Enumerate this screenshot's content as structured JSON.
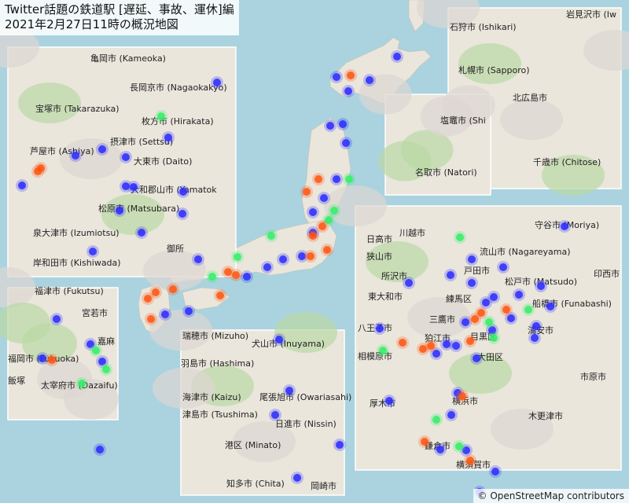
{
  "title": {
    "line1": "Twitter話題の鉄道駅 [遅延、事故、運休]編",
    "line2": "2021年2月27日11時の概況地図"
  },
  "attribution": "© OpenStreetMap contributors",
  "colors": {
    "sea": "#aad3df",
    "land": "#eae6dc",
    "forest": "#b9d8a4",
    "urban": "#ddd6d2",
    "marker_blue": "#2a2aff",
    "marker_green": "#33ee66",
    "marker_orange": "#ff5511"
  },
  "insets": [
    {
      "id": "kansai",
      "labels": [
        "亀岡市 (Kameoka)",
        "長岡京市 (Nagaokakyo)",
        "宝塚市 (Takarazuka)",
        "枚方市 (Hirakata)",
        "摂津市 (Settsu)",
        "芦屋市 (Ashiya)",
        "大東市 (Daito)",
        "大和郡山市 (Yamatok",
        "松原市 (Matsubara)",
        "泉大津市 (Izumiotsu)",
        "岸和田市 (Kishiwada)",
        "御所"
      ]
    },
    {
      "id": "sapporo",
      "labels": [
        "石狩市 (Ishikari)",
        "岩見沢市 (Iw",
        "札幌市 (Sapporo)",
        "北広島市",
        "千歳市 (Chitose)"
      ]
    },
    {
      "id": "sendai",
      "labels": [
        "塩竈市 (Shi",
        "名取市 (Natori)"
      ]
    },
    {
      "id": "tokyo",
      "labels": [
        "川越市",
        "守谷市 (Moriya)",
        "日高市",
        "狭山市",
        "所沢市",
        "戸田市",
        "流山市 (Nagareyama)",
        "印西市",
        "東大和市",
        "練馬区",
        "松戸市 (Matsudo)",
        "船橋市 (Funabashi)",
        "三鷹市",
        "八王子市",
        "狛江市",
        "目黒区",
        "浦安市",
        "相模原市",
        "大田区",
        "厚木市",
        "横浜市",
        "市原市",
        "木更津市",
        "鎌倉市",
        "横須賀市"
      ]
    },
    {
      "id": "fukuoka",
      "labels": [
        "福津市 (Fukutsu)",
        "宮若市",
        "福岡市 (Fukuoka)",
        "嘉麻",
        "太宰府市 (Dazaifu)",
        "飯塚"
      ]
    },
    {
      "id": "nagoya",
      "labels": [
        "瑞穂市 (Mizuho)",
        "犬山市 (Inuyama)",
        "羽島市 (Hashima)",
        "海津市 (Kaizu)",
        "尾張旭市 (Owariasahi)",
        "津島市 (Tsushima)",
        "日進市 (Nissin)",
        "港区 (Minato)",
        "知多市 (Chita)",
        "岡崎市"
      ]
    }
  ]
}
